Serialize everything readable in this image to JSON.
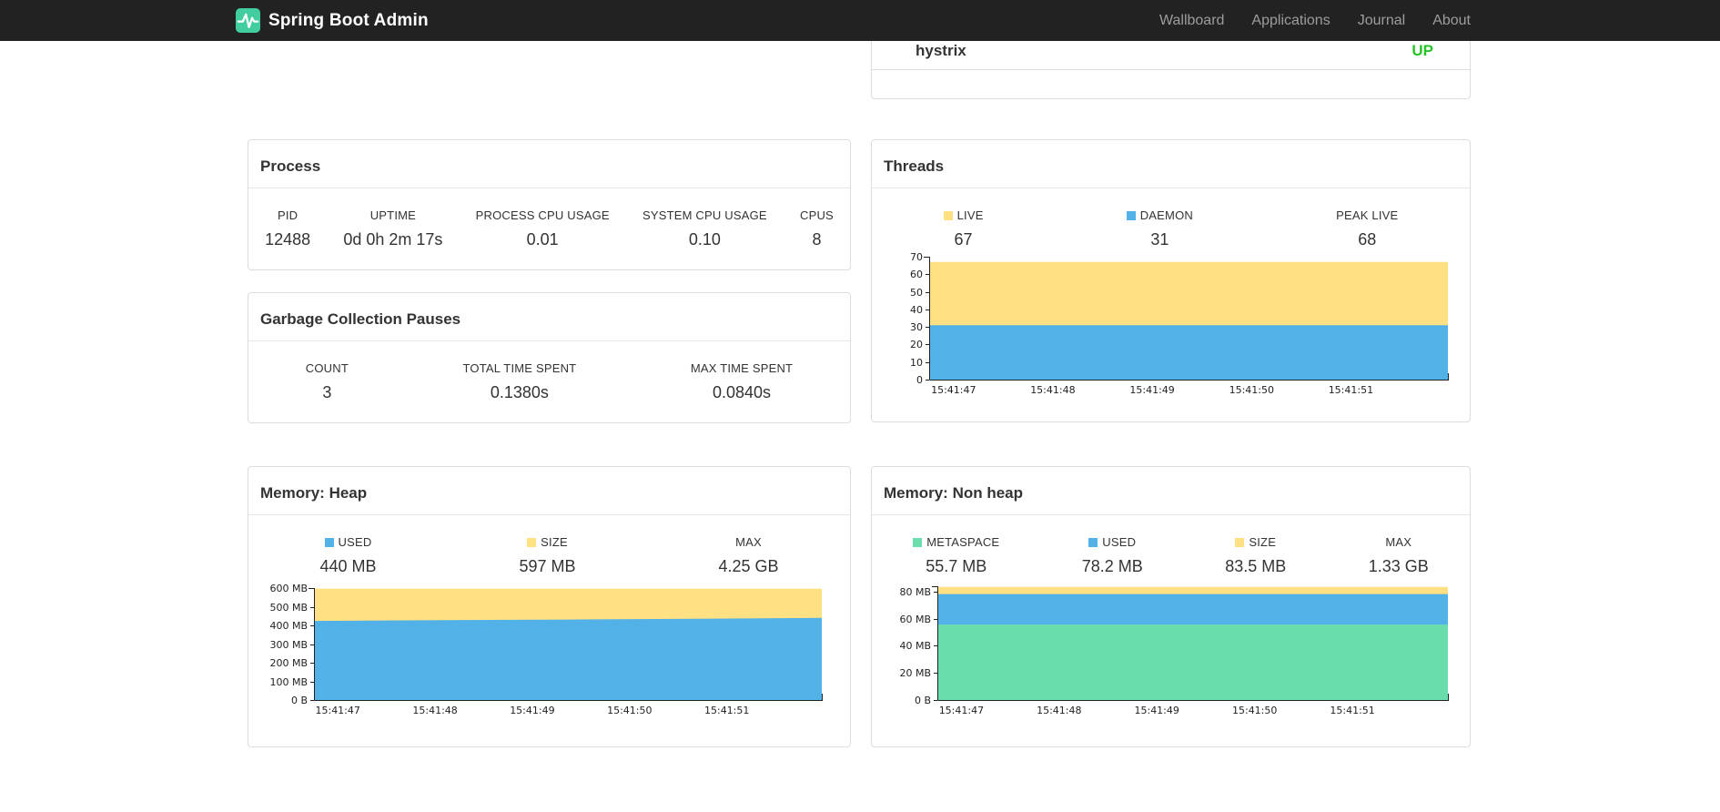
{
  "navbar": {
    "brand": "Spring Boot Admin",
    "links": [
      {
        "label": "Wallboard"
      },
      {
        "label": "Applications"
      },
      {
        "label": "Journal"
      },
      {
        "label": "About"
      }
    ]
  },
  "colors": {
    "navbar_bg": "#222222",
    "brand_green": "#41cda0",
    "status_up_green": "#27c327",
    "series_yellow": "#ffe082",
    "series_blue": "#52b2e8",
    "series_green": "#6bdcac"
  },
  "service_row": {
    "name": "hystrix",
    "status": "UP"
  },
  "cards": {
    "process": {
      "title": "Process",
      "stats": [
        {
          "label": "PID",
          "value": "12488"
        },
        {
          "label": "UPTIME",
          "value": "0d 0h 2m 17s"
        },
        {
          "label": "PROCESS CPU USAGE",
          "value": "0.01"
        },
        {
          "label": "SYSTEM CPU USAGE",
          "value": "0.10"
        },
        {
          "label": "CPUS",
          "value": "8"
        }
      ]
    },
    "gc": {
      "title": "Garbage Collection Pauses",
      "stats": [
        {
          "label": "COUNT",
          "value": "3"
        },
        {
          "label": "TOTAL TIME SPENT",
          "value": "0.1380s"
        },
        {
          "label": "MAX TIME SPENT",
          "value": "0.0840s"
        }
      ]
    },
    "threads": {
      "title": "Threads",
      "legend": [
        {
          "label": "LIVE",
          "value": "67",
          "color": "#ffe082"
        },
        {
          "label": "DAEMON",
          "value": "31",
          "color": "#52b2e8"
        },
        {
          "label": "PEAK LIVE",
          "value": "68",
          "color": null
        }
      ]
    },
    "heap": {
      "title": "Memory: Heap",
      "legend": [
        {
          "label": "USED",
          "value": "440 MB",
          "color": "#52b2e8"
        },
        {
          "label": "SIZE",
          "value": "597 MB",
          "color": "#ffe082"
        },
        {
          "label": "MAX",
          "value": "4.25 GB",
          "color": null
        }
      ]
    },
    "nonheap": {
      "title": "Memory: Non heap",
      "legend": [
        {
          "label": "METASPACE",
          "value": "55.7 MB",
          "color": "#6bdcac"
        },
        {
          "label": "USED",
          "value": "78.2 MB",
          "color": "#52b2e8"
        },
        {
          "label": "SIZE",
          "value": "83.5 MB",
          "color": "#ffe082"
        },
        {
          "label": "MAX",
          "value": "1.33 GB",
          "color": null
        }
      ]
    }
  },
  "chart_data": [
    {
      "id": "threads",
      "type": "area",
      "title": "Threads",
      "x": [
        "15:41:47",
        "15:41:48",
        "15:41:49",
        "15:41:50",
        "15:41:51"
      ],
      "ylim": [
        0,
        70
      ],
      "yticks": [
        {
          "v": 0,
          "label": "0"
        },
        {
          "v": 10,
          "label": "10"
        },
        {
          "v": 20,
          "label": "20"
        },
        {
          "v": 30,
          "label": "30"
        },
        {
          "v": 40,
          "label": "40"
        },
        {
          "v": 50,
          "label": "50"
        },
        {
          "v": 60,
          "label": "60"
        },
        {
          "v": 70,
          "label": "70"
        }
      ],
      "series": [
        {
          "name": "LIVE",
          "color": "#ffe082",
          "values": [
            67,
            67,
            67,
            67,
            67
          ]
        },
        {
          "name": "DAEMON",
          "color": "#52b2e8",
          "values": [
            31,
            31,
            31,
            31,
            31
          ]
        }
      ]
    },
    {
      "id": "heap",
      "type": "area",
      "title": "Memory: Heap",
      "x": [
        "15:41:47",
        "15:41:48",
        "15:41:49",
        "15:41:50",
        "15:41:51"
      ],
      "ylim": [
        0,
        600
      ],
      "yticks": [
        {
          "v": 0,
          "label": "0 B"
        },
        {
          "v": 100,
          "label": "100 MB"
        },
        {
          "v": 200,
          "label": "200 MB"
        },
        {
          "v": 300,
          "label": "300 MB"
        },
        {
          "v": 400,
          "label": "400 MB"
        },
        {
          "v": 500,
          "label": "500 MB"
        },
        {
          "v": 600,
          "label": "600 MB"
        }
      ],
      "series": [
        {
          "name": "SIZE",
          "color": "#ffe082",
          "values": [
            597,
            597,
            597,
            597,
            597
          ]
        },
        {
          "name": "USED",
          "color": "#52b2e8",
          "values": [
            424,
            428,
            431,
            435,
            440
          ]
        }
      ]
    },
    {
      "id": "nonheap",
      "type": "area",
      "title": "Memory: Non heap",
      "x": [
        "15:41:47",
        "15:41:48",
        "15:41:49",
        "15:41:50",
        "15:41:51"
      ],
      "ylim": [
        0,
        84
      ],
      "yticks": [
        {
          "v": 0,
          "label": "0 B"
        },
        {
          "v": 20,
          "label": "20 MB"
        },
        {
          "v": 40,
          "label": "40 MB"
        },
        {
          "v": 60,
          "label": "60 MB"
        },
        {
          "v": 80,
          "label": "80 MB"
        }
      ],
      "series": [
        {
          "name": "SIZE",
          "color": "#ffe082",
          "values": [
            83.5,
            83.5,
            83.5,
            83.5,
            83.5
          ]
        },
        {
          "name": "USED",
          "color": "#52b2e8",
          "values": [
            78.2,
            78.2,
            78.2,
            78.2,
            78.2
          ]
        },
        {
          "name": "METASPACE",
          "color": "#6bdcac",
          "values": [
            55.7,
            55.7,
            55.7,
            55.7,
            55.7
          ]
        }
      ]
    }
  ]
}
